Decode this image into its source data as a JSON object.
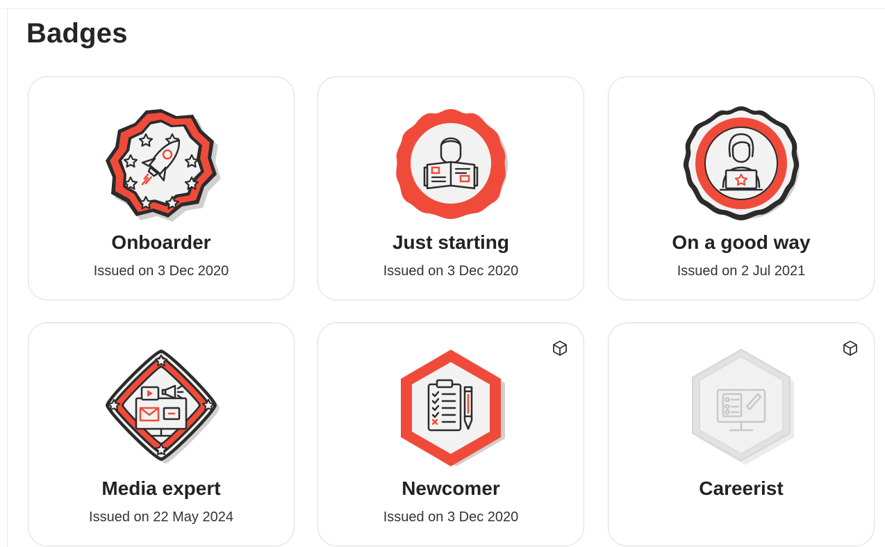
{
  "page": {
    "title": "Badges"
  },
  "badges": [
    {
      "name": "Onboarder",
      "issued": "Issued on 3 Dec 2020",
      "icon": "rocket-badge-icon",
      "earned": true,
      "has_3d": false
    },
    {
      "name": "Just starting",
      "issued": "Issued on 3 Dec 2020",
      "icon": "reader-badge-icon",
      "earned": true,
      "has_3d": false
    },
    {
      "name": "On a good way",
      "issued": "Issued on 2 Jul 2021",
      "icon": "laptop-user-badge-icon",
      "earned": true,
      "has_3d": false
    },
    {
      "name": "Media expert",
      "issued": "Issued on 22 May 2024",
      "icon": "media-badge-icon",
      "earned": true,
      "has_3d": false
    },
    {
      "name": "Newcomer",
      "issued": "Issued on 3 Dec 2020",
      "icon": "checklist-badge-icon",
      "earned": true,
      "has_3d": true
    },
    {
      "name": "Careerist",
      "issued": "",
      "icon": "monitor-checklist-badge-icon",
      "earned": false,
      "has_3d": true
    }
  ],
  "colors": {
    "accent": "#f04b3a",
    "dark": "#2b2b2b",
    "inner": "#f2f2f2",
    "locked": "#dedede"
  }
}
